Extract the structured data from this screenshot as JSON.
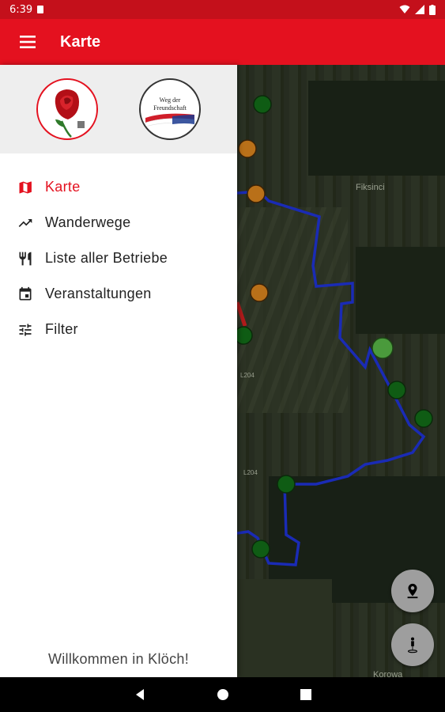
{
  "status": {
    "time": "6:39"
  },
  "appbar": {
    "title": "Karte"
  },
  "drawer": {
    "logo1": "logo-rose",
    "logo2_text": [
      "Weg der",
      "Freundschaft"
    ],
    "items": [
      {
        "label": "Karte",
        "icon": "map-icon",
        "active": true
      },
      {
        "label": "Wanderwege",
        "icon": "trending-icon",
        "active": false
      },
      {
        "label": "Liste aller Betriebe",
        "icon": "restaurant-icon",
        "active": false
      },
      {
        "label": "Veranstaltungen",
        "icon": "calendar-icon",
        "active": false
      },
      {
        "label": "Filter",
        "icon": "tune-icon",
        "active": false
      }
    ],
    "welcome": "Willkommen in Klöch!"
  },
  "map": {
    "labels": {
      "fiksinci": "Fiksinci",
      "road1": "L204",
      "road2": "L204",
      "place": "Korowa"
    }
  },
  "colors": {
    "accent": "#e4111f"
  }
}
